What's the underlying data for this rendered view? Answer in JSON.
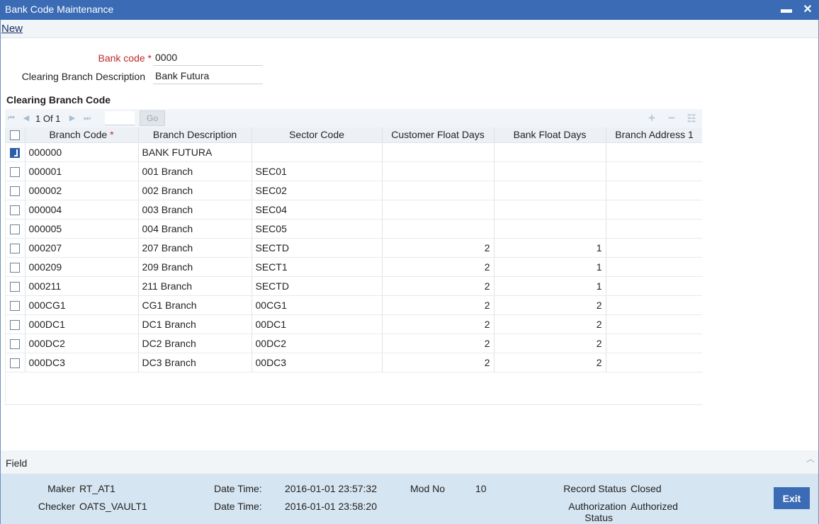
{
  "window": {
    "title": "Bank Code Maintenance",
    "min_glyph": "▬",
    "close_glyph": "✕"
  },
  "toolbar": {
    "new_label": "New"
  },
  "form": {
    "bank_code_label": "Bank code",
    "bank_code_required": "*",
    "bank_code_value": "0000",
    "clearing_desc_label": "Clearing Branch Description",
    "clearing_desc_value": "Bank Futura"
  },
  "section": {
    "title": "Clearing Branch Code"
  },
  "pagination": {
    "info": "1 Of 1",
    "go_label": "Go"
  },
  "table": {
    "headers": [
      "Branch Code",
      "Branch Description",
      "Sector Code",
      "Customer Float Days",
      "Bank Float Days",
      "Branch Address 1"
    ],
    "required_marker": "*",
    "rows": [
      {
        "checked": true,
        "code": "000000",
        "desc": "BANK FUTURA",
        "sector": "",
        "cfd": "",
        "bfd": "",
        "addr": ""
      },
      {
        "checked": false,
        "code": "000001",
        "desc": "001 Branch",
        "sector": "SEC01",
        "cfd": "",
        "bfd": "",
        "addr": ""
      },
      {
        "checked": false,
        "code": "000002",
        "desc": "002 Branch",
        "sector": "SEC02",
        "cfd": "",
        "bfd": "",
        "addr": ""
      },
      {
        "checked": false,
        "code": "000004",
        "desc": "003 Branch",
        "sector": "SEC04",
        "cfd": "",
        "bfd": "",
        "addr": ""
      },
      {
        "checked": false,
        "code": "000005",
        "desc": "004 Branch",
        "sector": "SEC05",
        "cfd": "",
        "bfd": "",
        "addr": ""
      },
      {
        "checked": false,
        "code": "000207",
        "desc": "207 Branch",
        "sector": "SECTD",
        "cfd": "2",
        "bfd": "1",
        "addr": ""
      },
      {
        "checked": false,
        "code": "000209",
        "desc": "209 Branch",
        "sector": "SECT1",
        "cfd": "2",
        "bfd": "1",
        "addr": ""
      },
      {
        "checked": false,
        "code": "000211",
        "desc": "211 Branch",
        "sector": "SECTD",
        "cfd": "2",
        "bfd": "1",
        "addr": ""
      },
      {
        "checked": false,
        "code": "000CG1",
        "desc": "CG1 Branch",
        "sector": "00CG1",
        "cfd": "2",
        "bfd": "2",
        "addr": ""
      },
      {
        "checked": false,
        "code": "000DC1",
        "desc": "DC1 Branch",
        "sector": "00DC1",
        "cfd": "2",
        "bfd": "2",
        "addr": ""
      },
      {
        "checked": false,
        "code": "000DC2",
        "desc": "DC2 Branch",
        "sector": "00DC2",
        "cfd": "2",
        "bfd": "2",
        "addr": ""
      },
      {
        "checked": false,
        "code": "000DC3",
        "desc": "DC3 Branch",
        "sector": "00DC3",
        "cfd": "2",
        "bfd": "2",
        "addr": ""
      }
    ]
  },
  "fields_bar": {
    "label": "Field"
  },
  "audit": {
    "maker_label": "Maker",
    "maker_value": "RT_AT1",
    "checker_label": "Checker",
    "checker_value": "OATS_VAULT1",
    "date_time_label": "Date Time:",
    "maker_date": "2016-01-01 23:57:32",
    "checker_date": "2016-01-01 23:58:20",
    "mod_no_label": "Mod No",
    "mod_no_value": "10",
    "record_status_label": "Record Status",
    "record_status_value": "Closed",
    "auth_status_label_1": "Authorization",
    "auth_status_label_2": "Status",
    "auth_status_value": "Authorized",
    "exit_label": "Exit"
  },
  "colors": {
    "titlebar": "#3a6bb4",
    "audit_bg": "#d5e5f1",
    "required": "#c0282b"
  }
}
